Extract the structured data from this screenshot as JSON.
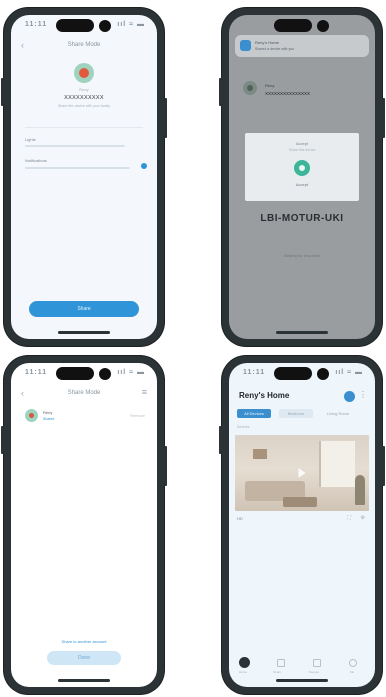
{
  "phone1": {
    "status_time": "11:11",
    "status_icons": "ııl ≈ ▬",
    "header_title": "Share Mode",
    "profile_name": "Reny",
    "account_id": "XXXXXXXXXX",
    "account_note": "Share this device with your family",
    "label_1": "Lights",
    "label_2": "Notifications",
    "confirm_button": "Share"
  },
  "phone2": {
    "status_time": "11:11",
    "status_icons": "ııl ≈ ▬",
    "notification_title": "Reny's Home",
    "notification_body": "Shared a device with you",
    "profile_name": "Reny",
    "account_id": "XXXXXXXXXXXXXXX",
    "dialog_title": "Accept",
    "dialog_text": "Share this device",
    "dialog_ok": "Accept",
    "dialog_overlay_text": "LBI-MOTUR-UKI",
    "bottom_text": "Waiting for response"
  },
  "phone3": {
    "status_time": "11:11",
    "status_icons": "ııl ≈ ▬",
    "header_title": "Share Mode",
    "user_name": "Reny",
    "user_sub": "Shared",
    "user_action": "Remove",
    "link_text": "Share to another account",
    "done_button": "Done"
  },
  "phone4": {
    "status_time": "11:11",
    "status_icons": "ııl ≈ ▬",
    "home_title": "Reny's Home",
    "chips": [
      "All Devices",
      "Bedroom",
      "Living Room"
    ],
    "section_label": "Devices",
    "camera_label": "HD",
    "nav_items": [
      "Home",
      "Smart",
      "Scenes",
      "Me"
    ]
  }
}
